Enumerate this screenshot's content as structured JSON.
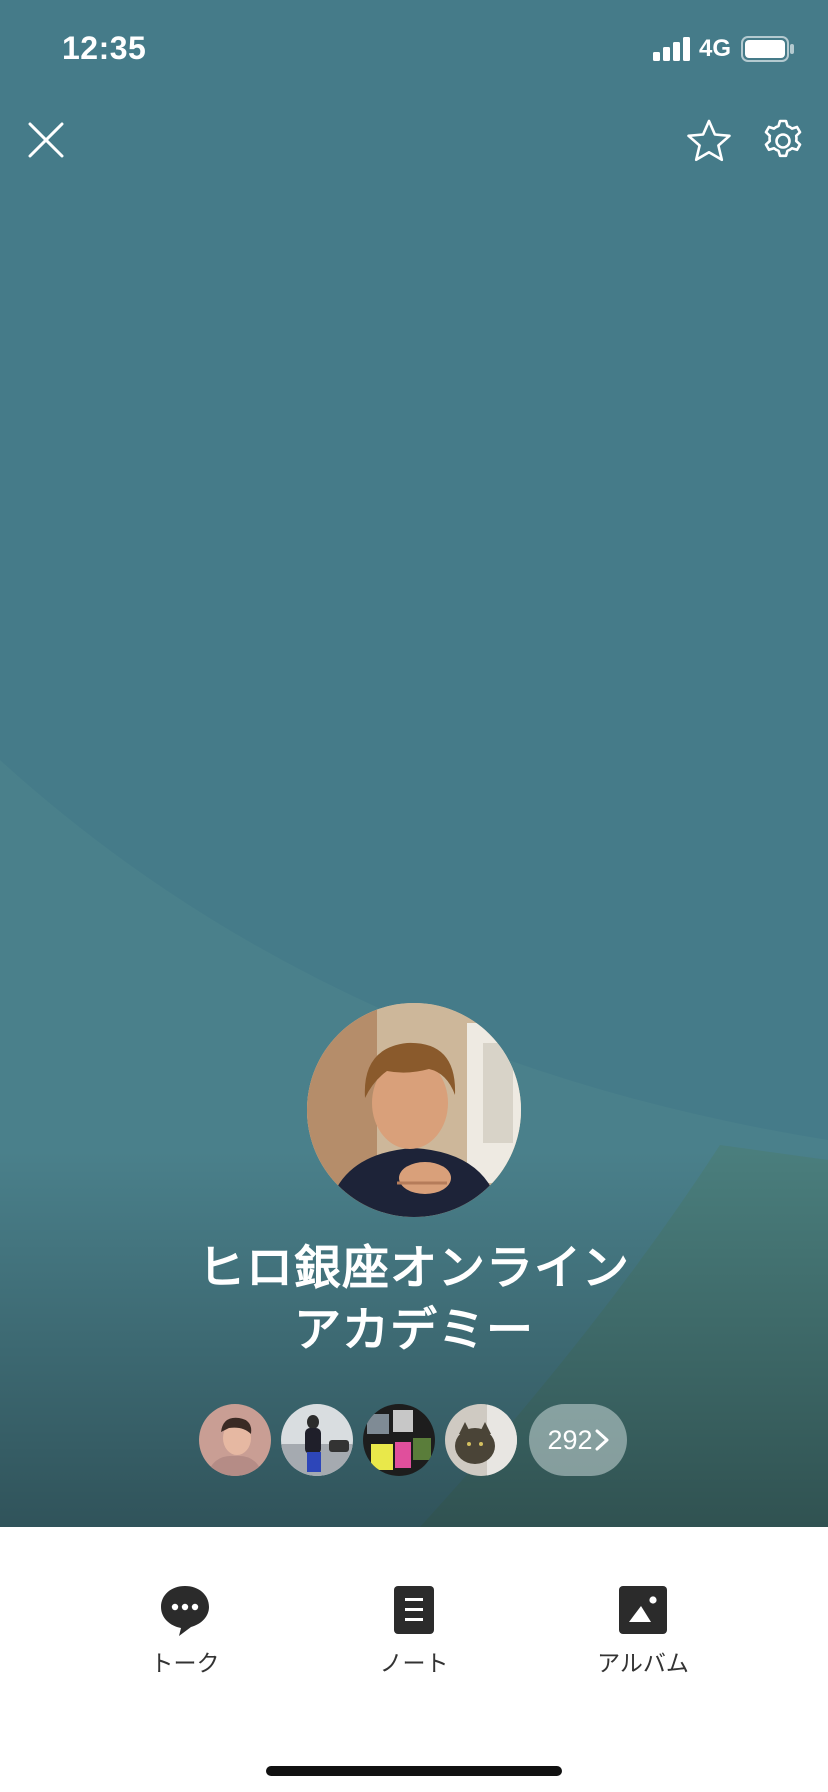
{
  "status_bar": {
    "time": "12:35",
    "network": "4G"
  },
  "group": {
    "name_line1": "ヒロ銀座オンライン",
    "name_line2": "アカデミー",
    "member_count": "292"
  },
  "tabs": [
    {
      "label": "トーク",
      "icon": "chat-bubble-icon"
    },
    {
      "label": "ノート",
      "icon": "note-icon"
    },
    {
      "label": "アルバム",
      "icon": "album-icon"
    }
  ],
  "colors": {
    "cover": "#457b89",
    "cover_dark": "#2f5a60",
    "pill": "#a9c0bf",
    "tab_icon": "#2b2b2b"
  }
}
